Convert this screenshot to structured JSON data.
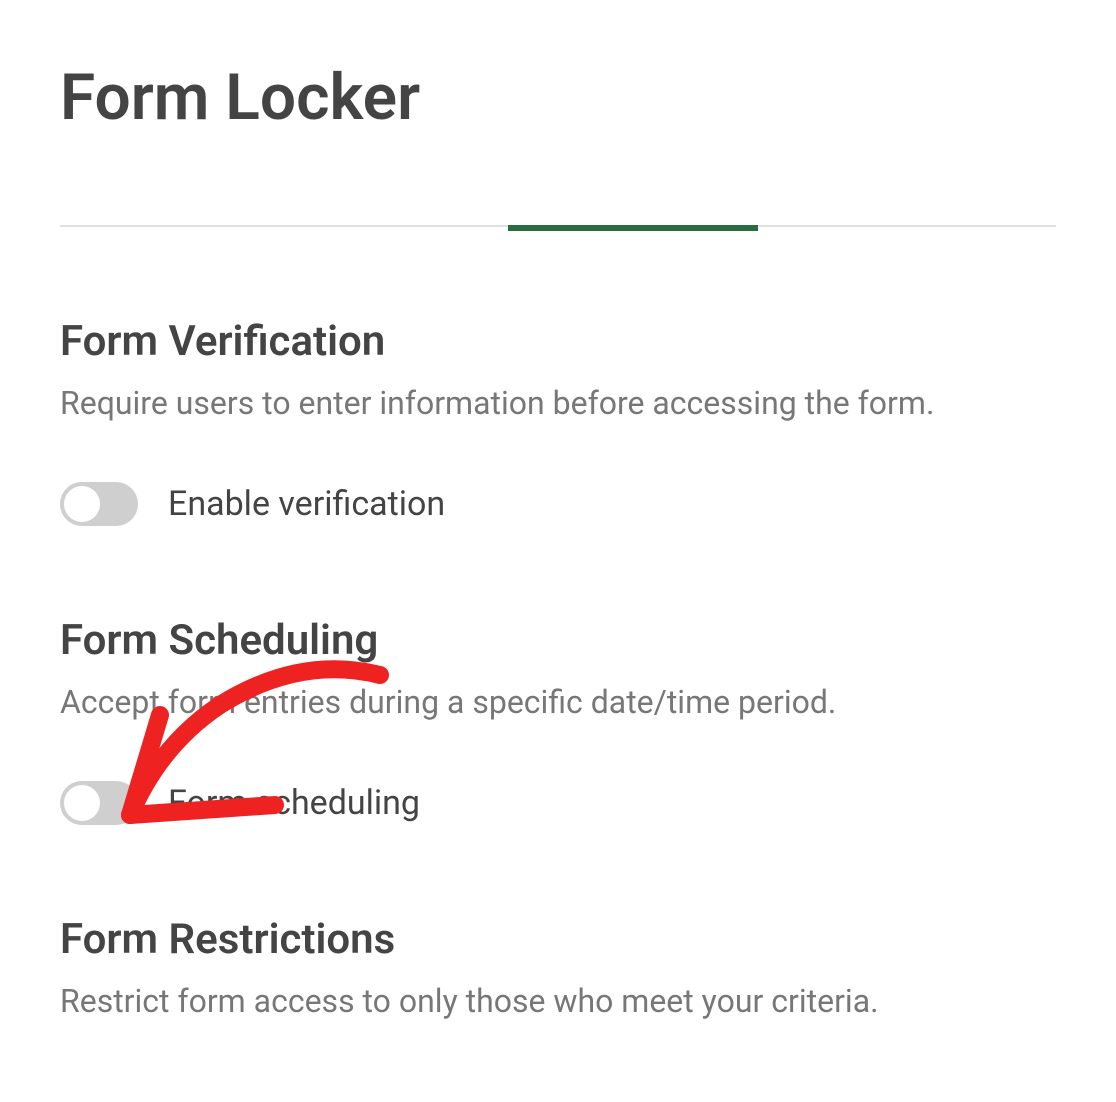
{
  "header": {
    "title": "Form Locker"
  },
  "sections": {
    "verification": {
      "title": "Form Verification",
      "description": "Require users to enter information before accessing the form.",
      "toggle_label": "Enable verification",
      "toggle_state": "off"
    },
    "scheduling": {
      "title": "Form Scheduling",
      "description": "Accept form entries during a specific date/time period.",
      "toggle_label": "Form scheduling",
      "toggle_state": "off"
    },
    "restrictions": {
      "title": "Form Restrictions",
      "description": "Restrict form access to only those who meet your criteria."
    }
  },
  "colors": {
    "accent": "#2a6b3f",
    "annotation": "#ef2222"
  }
}
